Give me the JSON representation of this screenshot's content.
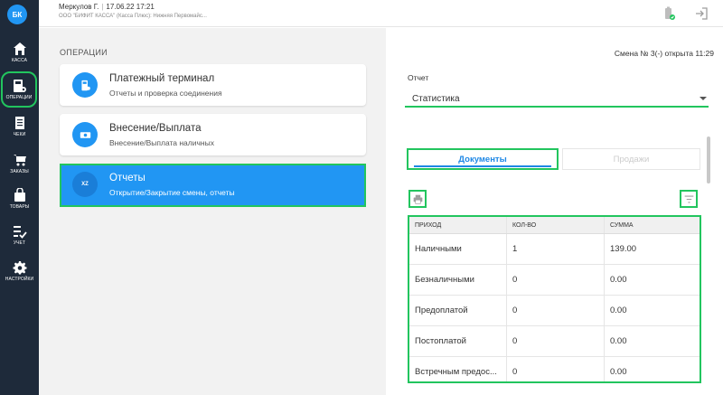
{
  "sidebar": {
    "logo": "БК",
    "items": [
      {
        "label": "КАССА",
        "icon": "home-icon"
      },
      {
        "label": "ОПЕРАЦИИ",
        "icon": "cash-register-icon",
        "active": true
      },
      {
        "label": "ЧЕКИ",
        "icon": "receipt-icon"
      },
      {
        "label": "ЗАКАЗЫ",
        "icon": "cart-icon"
      },
      {
        "label": "ТОВАРЫ",
        "icon": "bag-icon"
      },
      {
        "label": "УЧЕТ",
        "icon": "checklist-icon"
      },
      {
        "label": "НАСТРОЙКИ",
        "icon": "gear-icon"
      }
    ]
  },
  "header": {
    "user": "Меркулов Г.",
    "datetime": "17.06.22 17:21",
    "org": "ООО \"БИФИТ КАССА\" (Касса Плюс): Нижняя Первомайс...",
    "icons": [
      "device-status-icon",
      "logout-icon"
    ]
  },
  "operations": {
    "section_title": "ОПЕРАЦИИ",
    "cards": [
      {
        "title": "Платежный терминал",
        "subtitle": "Отчеты и проверка соединения",
        "icon": "terminal-icon"
      },
      {
        "title": "Внесение/Выплата",
        "subtitle": "Внесение/Выплата наличных",
        "icon": "money-icon"
      },
      {
        "title": "Отчеты",
        "subtitle": "Открытие/Закрытие смены, отчеты",
        "icon": "xz-report-icon",
        "icon_text": "XZ",
        "active": true
      }
    ]
  },
  "report": {
    "shift_status": "Смена № 3(-) открыта 11:29",
    "label": "Отчет",
    "selected": "Статистика",
    "tabs": [
      {
        "label": "Документы",
        "active": true
      },
      {
        "label": "Продажи",
        "active": false
      }
    ],
    "table": {
      "headers": [
        "ПРИХОД",
        "КОЛ-ВО",
        "СУММА"
      ],
      "rows": [
        [
          "Наличными",
          "1",
          "139.00"
        ],
        [
          "Безналичными",
          "0",
          "0.00"
        ],
        [
          "Предоплатой",
          "0",
          "0.00"
        ],
        [
          "Постоплатой",
          "0",
          "0.00"
        ],
        [
          "Встречным предос...",
          "0",
          "0.00"
        ]
      ]
    }
  },
  "colors": {
    "sidebar_bg": "#1e2a3a",
    "accent": "#2196f3",
    "highlight": "#22c55e"
  }
}
